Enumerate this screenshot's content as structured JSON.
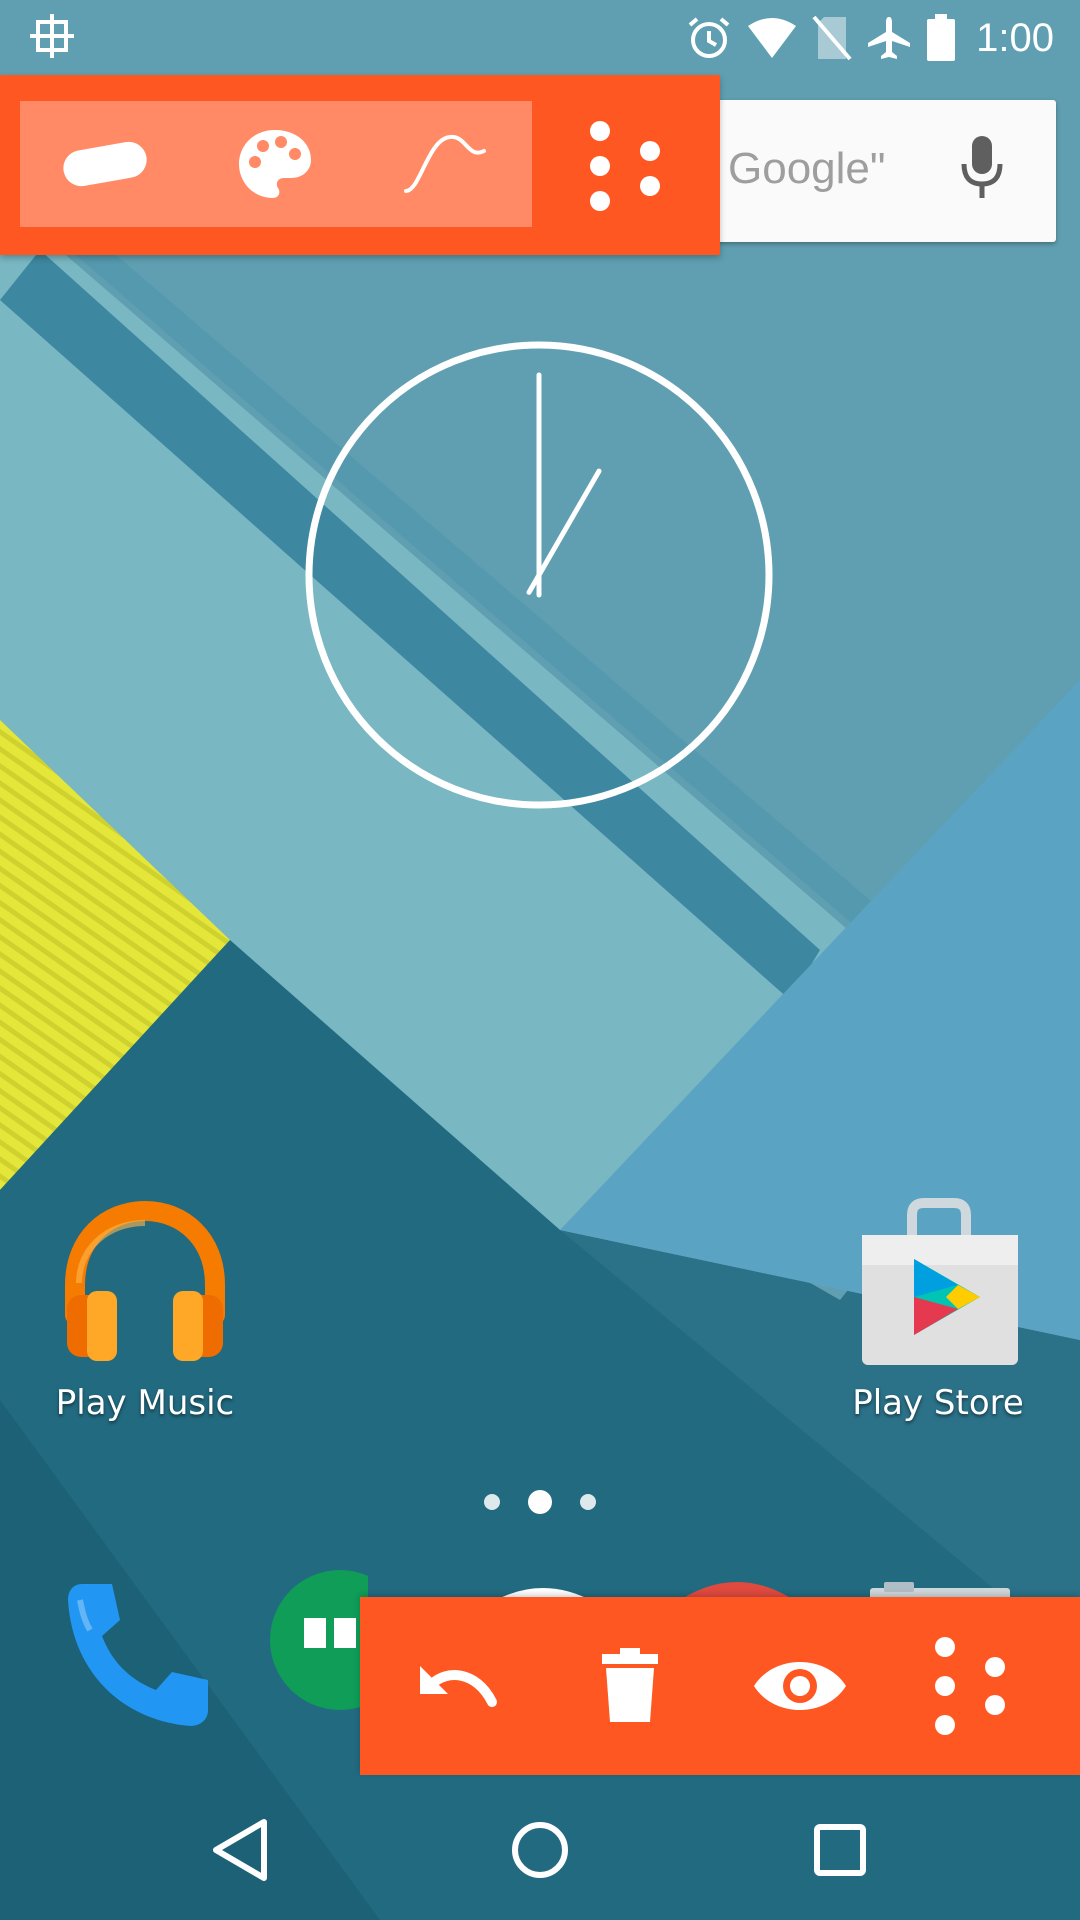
{
  "status_bar": {
    "time": "1:00",
    "icons": [
      "crosshair-icon",
      "alarm-icon",
      "wifi-icon",
      "no-sim-icon",
      "airplane-icon",
      "battery-icon"
    ]
  },
  "search_widget": {
    "text": "Google\""
  },
  "top_toolbar": {
    "tools": [
      "brush-size-icon",
      "palette-icon",
      "stroke-style-icon"
    ],
    "menu": "menu-dots-icon"
  },
  "clock": {
    "hour": 1,
    "minute": 0
  },
  "apps": [
    {
      "label": "Play Music",
      "icon": "headphones-icon"
    },
    {
      "label": "Play Store",
      "icon": "play-store-icon"
    }
  ],
  "pager": {
    "pages": 3,
    "current": 2
  },
  "dock": [
    "phone-icon",
    "hangouts-icon",
    "chrome-icon",
    "gmail-icon",
    "camera-icon"
  ],
  "bottom_toolbar": {
    "tools": [
      "undo-icon",
      "trash-icon",
      "eye-icon",
      "menu-dots-icon"
    ]
  },
  "nav_bar": [
    "back-icon",
    "home-icon",
    "recents-icon"
  ],
  "colors": {
    "toolbar": "#ff5722",
    "tool_panel": "#ff8a65",
    "wallpaper_light": "#7fbcc6",
    "wallpaper_dark": "#1f6378",
    "yellow": "#e6e63c"
  }
}
